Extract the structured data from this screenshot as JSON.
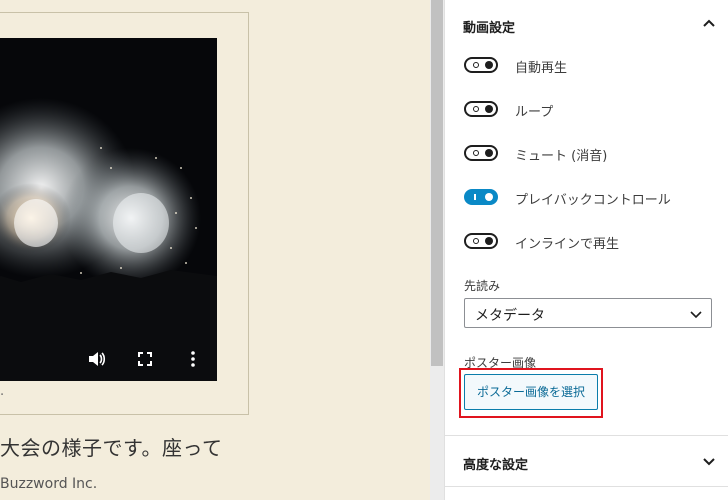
{
  "canvas": {
    "caption_fragment": ".",
    "body_text": "大会の様子です。座って",
    "footer_text": "Buzzword Inc."
  },
  "video_controls": {
    "icons": [
      "volume-icon",
      "fullscreen-icon",
      "more-options-icon"
    ]
  },
  "panel": {
    "title": "動画設定",
    "toggles": [
      {
        "label": "自動再生",
        "checked": false
      },
      {
        "label": "ループ",
        "checked": false
      },
      {
        "label": "ミュート (消音)",
        "checked": false
      },
      {
        "label": "プレイバックコントロール",
        "checked": true
      },
      {
        "label": "インラインで再生",
        "checked": false
      }
    ],
    "preload_label": "先読み",
    "preload_value": "メタデータ",
    "poster_label": "ポスター画像",
    "poster_button": "ポスター画像を選択"
  },
  "advanced": {
    "title": "高度な設定"
  },
  "colors": {
    "accent": "#0a89c6",
    "highlight": "#e0141e",
    "canvas_bg": "#f3eddc"
  }
}
